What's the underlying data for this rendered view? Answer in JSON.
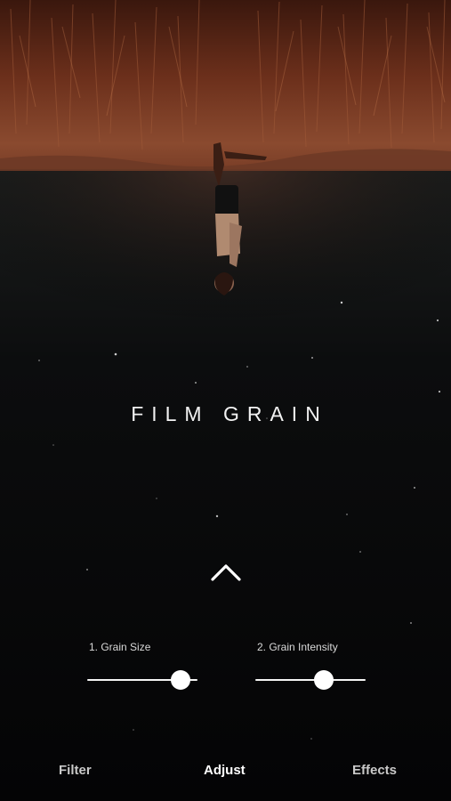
{
  "screen": {
    "title": "FILM GRAIN",
    "chevron_icon": "chevron-up-icon"
  },
  "sliders": [
    {
      "label": "1. Grain Size",
      "value": 0.85
    },
    {
      "label": "2. Grain Intensity",
      "value": 0.62
    }
  ],
  "tabs": {
    "filter": "Filter",
    "adjust": "Adjust",
    "effects": "Effects",
    "active": "adjust"
  },
  "colors": {
    "background": "#050507",
    "accent": "#ffffff",
    "grass": "#7a3a22",
    "ground_glow": "#5a3022"
  }
}
